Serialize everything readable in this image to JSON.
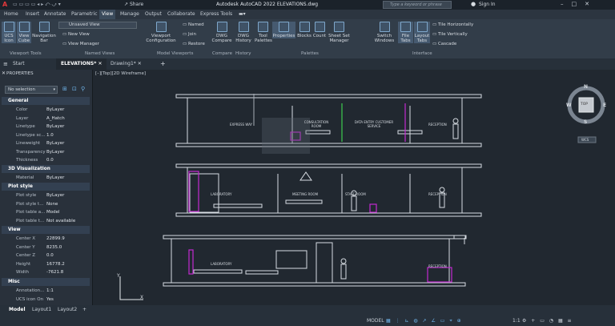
{
  "titlebar": {
    "share_label": "Share",
    "title": "Autodesk AutoCAD 2022    ELEVATIONS.dwg",
    "search_placeholder": "Type a keyword or phrase",
    "signin": "Sign In"
  },
  "menu": [
    "Home",
    "Insert",
    "Annotate",
    "Parametric",
    "View",
    "Manage",
    "Output",
    "Collaborate",
    "Express Tools"
  ],
  "ribbon": {
    "ucs_icon": "UCS Icon",
    "view_cube": "View Cube",
    "navigation_bar": "Navigation Bar",
    "viewport_tools": "Viewport Tools",
    "view_select": "Unsaved View",
    "new_view": "New View",
    "view_manager": "View Manager",
    "named_views": "Named Views",
    "viewport_config": "Viewport Configuration",
    "named": "Named",
    "join": "Join",
    "restore": "Restore",
    "model_viewports": "Model Viewports",
    "dwg_compare": "DWG Compare",
    "compare": "Compare",
    "dwg_history": "DWG History",
    "history": "History",
    "tool_palettes": "Tool Palettes",
    "properties": "Properties",
    "blocks": "Blocks",
    "count": "Count",
    "sheet_set_manager": "Sheet Set Manager",
    "palettes": "Palettes",
    "switch_windows": "Switch Windows",
    "file_tabs": "File Tabs",
    "layout_tabs": "Layout Tabs",
    "tile_h": "Tile Horizontally",
    "tile_v": "Tile Vertically",
    "cascade": "Cascade",
    "interface": "Interface"
  },
  "doctabs": [
    "Start",
    "ELEVATIONS*",
    "Drawing1*"
  ],
  "properties": {
    "title": "PROPERTIES",
    "selection": "No selection",
    "general": "General",
    "rows_general": [
      [
        "Color",
        "ByLayer"
      ],
      [
        "Layer",
        "A_Hatch"
      ],
      [
        "Linetype",
        "ByLayer"
      ],
      [
        "Linetype sc...",
        "1.0"
      ],
      [
        "Lineweight",
        "ByLayer"
      ],
      [
        "Transparency",
        "ByLayer"
      ],
      [
        "Thickness",
        "0.0"
      ]
    ],
    "viz3d": "3D Visualization",
    "rows_viz": [
      [
        "Material",
        "ByLayer"
      ]
    ],
    "plotstyle": "Plot style",
    "rows_plot": [
      [
        "Plot style",
        "ByLayer"
      ],
      [
        "Plot style t...",
        "None"
      ],
      [
        "Plot table a...",
        "Model"
      ],
      [
        "Plot table t...",
        "Not available"
      ]
    ],
    "view": "View",
    "rows_view": [
      [
        "Center X",
        "22899.9"
      ],
      [
        "Center Y",
        "8235.0"
      ],
      [
        "Center Z",
        "0.0"
      ],
      [
        "Height",
        "16778.2"
      ],
      [
        "Width",
        "-7621.8"
      ]
    ],
    "misc": "Misc",
    "rows_misc": [
      [
        "Annotation...",
        "1:1"
      ],
      [
        "UCS icon On",
        "Yes"
      ]
    ]
  },
  "canvas": {
    "viewport_label": "[–][Top][2D Wireframe]",
    "compass": {
      "n": "N",
      "e": "E",
      "s": "S",
      "w": "W",
      "top": "TOP",
      "wcs": "WCS"
    },
    "labels": {
      "express_way": "EXPRESS WAY",
      "consultation": "CONSULTATION ROOM",
      "data_entry": "DATA ENTRY CUSTOMER SERVICE",
      "reception1": "RECEPTION",
      "laboratory1": "LABORATORY",
      "meeting": "MEETING ROOM",
      "staff": "STAFF ROOM",
      "reception2": "RECEPTION",
      "laboratory2": "LABORATORY",
      "reception3": "RECEPTION"
    },
    "ucs_x": "X",
    "ucs_y": "Y"
  },
  "status": {
    "tabs": [
      "Model",
      "Layout1",
      "Layout2"
    ],
    "model": "MODEL",
    "scale": "1:1"
  },
  "colors": {
    "accent": "#4a8fd6",
    "magenta": "#c22ad1",
    "green": "#3bb54a"
  }
}
